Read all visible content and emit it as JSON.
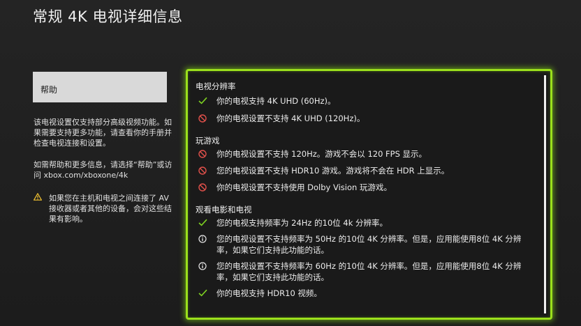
{
  "page": {
    "title": "常规 4K 电视详细信息"
  },
  "sidebar": {
    "help_button_label": "帮助",
    "description": "该电视设置仅支持部分高级视频功能。如果需要支持更多功能，请查看你的手册并检查电视连接和设置。",
    "more_info": "如需帮助和更多信息，请选择“帮助”或访问 xbox.com/xboxone/4k",
    "warning": "如果您在主机和电视之间连接了 AV 接收器或者其他的设备，会对这些结果有影响。"
  },
  "sections": [
    {
      "title": "电视分辨率",
      "items": [
        {
          "icon": "check-icon",
          "text": "你的电视支持 4K UHD (60Hz)。"
        },
        {
          "icon": "not-supported-icon",
          "text": "你的电视设置不支持 4K UHD (120Hz)。"
        }
      ]
    },
    {
      "title": "玩游戏",
      "items": [
        {
          "icon": "not-supported-icon",
          "text": "你的电视设置不支持 120Hz。游戏不会以 120 FPS 显示。"
        },
        {
          "icon": "not-supported-icon",
          "text": "您的电视设置不支持 HDR10 游戏。游戏将不会在 HDR 上显示。"
        },
        {
          "icon": "not-supported-icon",
          "text": "你的电视设置不支持使用 Dolby Vision 玩游戏。"
        }
      ]
    },
    {
      "title": "观看电影和电视",
      "items": [
        {
          "icon": "check-icon",
          "text": "您的电视支持频率为 24Hz 的10位 4k 分辨率。"
        },
        {
          "icon": "info-icon",
          "text": "您的电视设置不支持频率为 50Hz 的10位 4K 分辨率。但是，应用能使用8位 4K 分辨率，如果它们支持此功能的话。"
        },
        {
          "icon": "info-icon",
          "text": "您的电视设置不支持频率为 60Hz 的10位 4K 分辨率。但是，应用能使用8位 4K 分辨率，如果它们支持此功能的话。"
        },
        {
          "icon": "check-icon",
          "text": "你的电视支持 HDR10 视频。"
        }
      ]
    }
  ],
  "colors": {
    "accent_green": "#9be01c",
    "check_green": "#7fd321",
    "error_red": "#e0504a",
    "warning_yellow": "#f2c230"
  }
}
